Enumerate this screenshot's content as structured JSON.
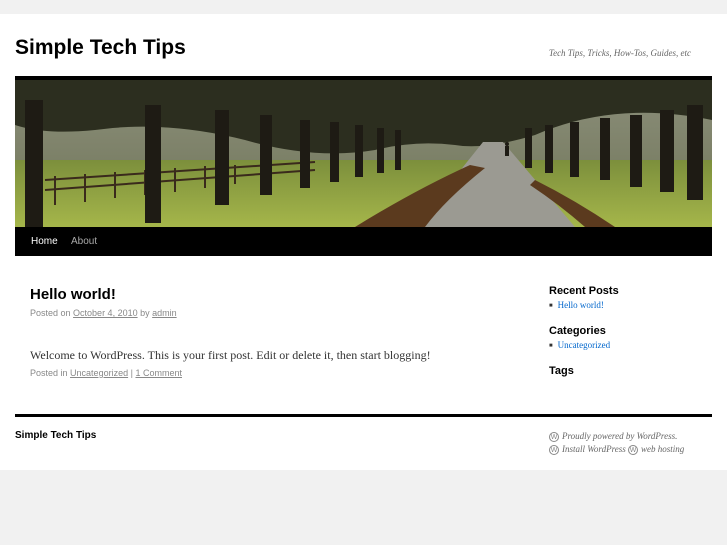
{
  "site": {
    "title": "Simple Tech Tips",
    "description": "Tech Tips, Tricks, How-Tos, Guides, etc"
  },
  "nav": {
    "items": [
      {
        "label": "Home",
        "current": true
      },
      {
        "label": "About",
        "current": false
      }
    ]
  },
  "post": {
    "title": "Hello world!",
    "posted_on": "Posted on",
    "date": "October 4, 2010",
    "by": "by",
    "author": "admin",
    "body": "Welcome to WordPress. This is your first post. Edit or delete it, then start blogging!",
    "posted_in": "Posted in",
    "category": "Uncategorized",
    "separator": "|",
    "comments": "1 Comment"
  },
  "sidebar": {
    "recent_posts_title": "Recent Posts",
    "recent_posts": [
      "Hello world!"
    ],
    "categories_title": "Categories",
    "categories": [
      "Uncategorized"
    ],
    "tags_title": "Tags"
  },
  "footer": {
    "title": "Simple Tech Tips",
    "powered": "Proudly powered by WordPress.",
    "install": "Install WordPress",
    "hosting": "web hosting"
  },
  "colors": {
    "link": "#0066cc",
    "menu_bg": "#000000",
    "page_bg": "#f1f1f1"
  },
  "header_image": "tree-lined-path-photo"
}
